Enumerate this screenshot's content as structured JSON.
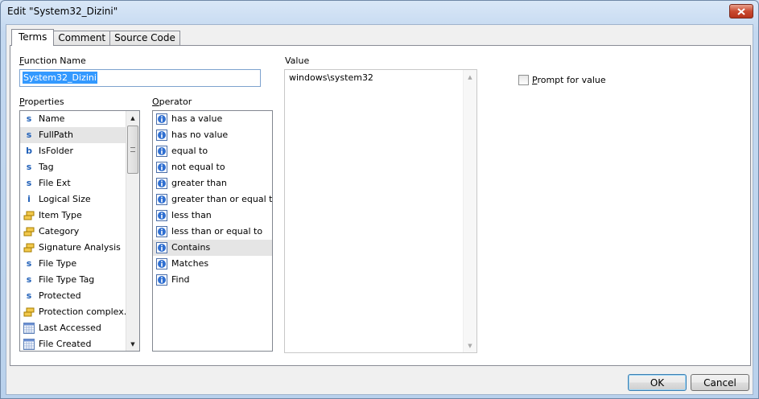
{
  "window": {
    "title": "Edit \"System32_Dizini\""
  },
  "tabs": [
    {
      "label": "Terms",
      "active": true
    },
    {
      "label": "Comment",
      "active": false
    },
    {
      "label": "Source Code",
      "active": false
    }
  ],
  "function_name": {
    "label_accel": "F",
    "label_rest": "unction Name",
    "value": "System32_Dizini"
  },
  "properties": {
    "label_accel": "P",
    "label_rest": "roperties",
    "items": [
      {
        "icon": "string-icon",
        "glyph": "s",
        "label": "Name"
      },
      {
        "icon": "string-icon",
        "glyph": "s",
        "label": "FullPath",
        "selected": true
      },
      {
        "icon": "boolean-icon",
        "glyph": "b",
        "label": "IsFolder"
      },
      {
        "icon": "string-icon",
        "glyph": "s",
        "label": "Tag"
      },
      {
        "icon": "string-icon",
        "glyph": "s",
        "label": "File Ext"
      },
      {
        "icon": "integer-icon",
        "glyph": "i",
        "label": "Logical Size"
      },
      {
        "icon": "enum-icon",
        "glyph": "",
        "label": "Item Type"
      },
      {
        "icon": "enum-icon",
        "glyph": "",
        "label": "Category"
      },
      {
        "icon": "enum-icon",
        "glyph": "",
        "label": "Signature Analysis"
      },
      {
        "icon": "string-icon",
        "glyph": "s",
        "label": "File Type"
      },
      {
        "icon": "string-icon",
        "glyph": "s",
        "label": "File Type Tag"
      },
      {
        "icon": "string-icon",
        "glyph": "s",
        "label": "Protected"
      },
      {
        "icon": "enum-icon",
        "glyph": "",
        "label": "Protection complex..."
      },
      {
        "icon": "calendar-icon",
        "glyph": "",
        "label": "Last Accessed"
      },
      {
        "icon": "calendar-icon",
        "glyph": "",
        "label": "File Created"
      }
    ]
  },
  "operator": {
    "label_accel": "O",
    "label_rest": "perator",
    "items": [
      {
        "label": "has a value"
      },
      {
        "label": "has no value"
      },
      {
        "label": "equal to"
      },
      {
        "label": "not equal to"
      },
      {
        "label": "greater than"
      },
      {
        "label": "greater than or equal to"
      },
      {
        "label": "less than"
      },
      {
        "label": "less than or equal to"
      },
      {
        "label": "Contains",
        "selected": true
      },
      {
        "label": "Matches"
      },
      {
        "label": "Find"
      }
    ]
  },
  "value": {
    "label": "Value",
    "text": "windows\\system32"
  },
  "prompt": {
    "label_accel": "P",
    "label_rest": "rompt for value",
    "checked": false
  },
  "buttons": {
    "ok": "OK",
    "cancel": "Cancel"
  },
  "colors": {
    "accent": "#1f5fb8",
    "selection": "#3399ff"
  }
}
